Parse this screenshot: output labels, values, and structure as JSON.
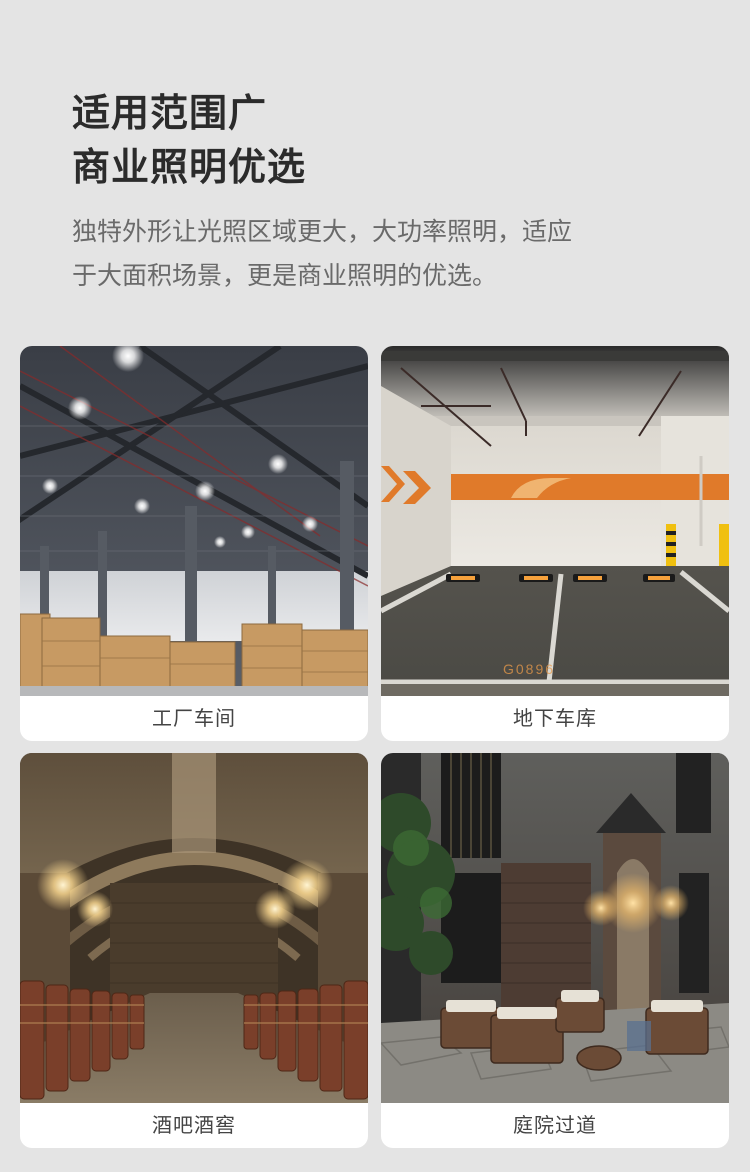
{
  "heading": {
    "line1": "适用范围广",
    "line2": "商业照明优选"
  },
  "description": {
    "line1": "独特外形让光照区域更大，大功率照明，适应",
    "line2": "于大面积场景，更是商业照明的优选。"
  },
  "scenes": [
    {
      "label": "工厂车间"
    },
    {
      "label": "地下车库"
    },
    {
      "label": "酒吧酒窖"
    },
    {
      "label": "庭院过道"
    }
  ],
  "garage_floor_marking": "G0896",
  "colors": {
    "page_background": "#e4e4e4",
    "card_background": "#ffffff",
    "heading_text": "#2b2b2b",
    "body_text": "#6a6a6a",
    "garage_stripe": "#e07a2a"
  }
}
